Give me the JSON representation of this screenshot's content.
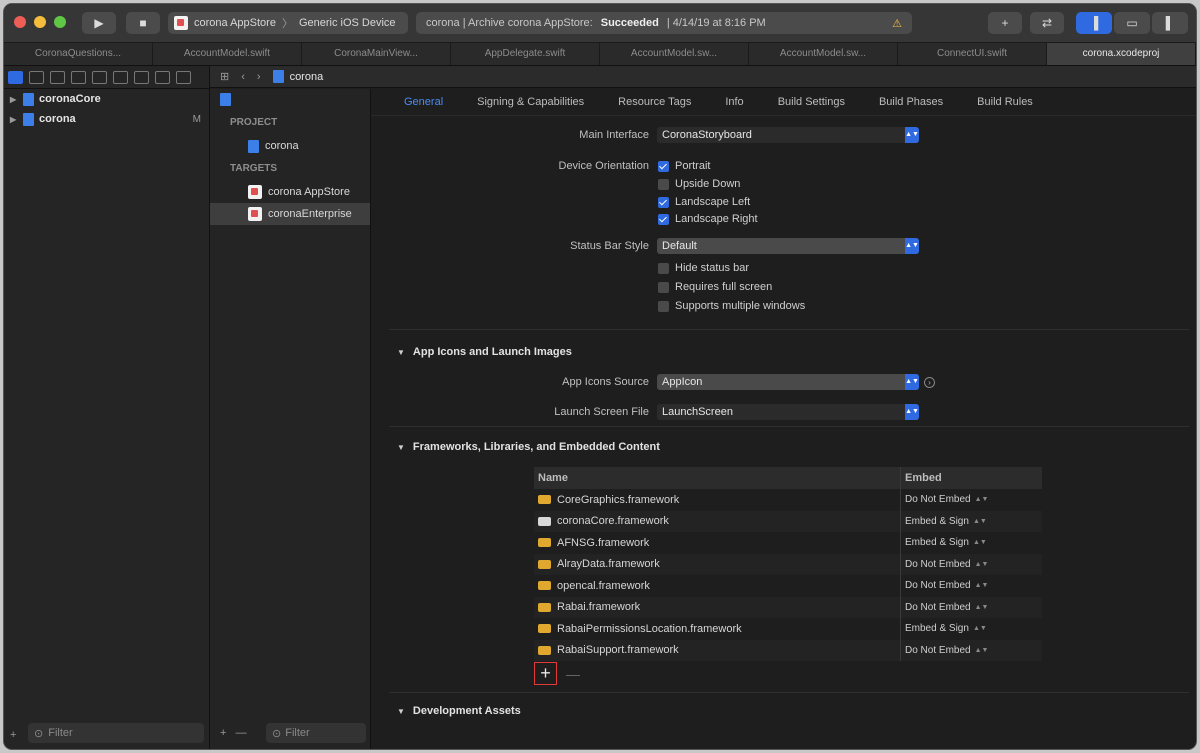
{
  "toolbar": {
    "run_icon": "play-icon",
    "stop_icon": "stop-icon",
    "scheme": "corona AppStore",
    "device": "Generic iOS Device",
    "activity_project": "corona | Archive corona AppStore:",
    "activity_status": "Succeeded",
    "activity_time": "| 4/14/19 at 8:16 PM",
    "warning_icon": "warning-icon"
  },
  "tabs": [
    "CoronaQuestions...",
    "AccountModel.swift",
    "CoronaMainView...",
    "AppDelegate.swift",
    "AccountModel.sw...",
    "AccountModel.sw...",
    "ConnectUI.swift",
    "corona.xcodeproj"
  ],
  "navigator": {
    "items": [
      {
        "label": "coronaCore",
        "badge": ""
      },
      {
        "label": "corona",
        "badge": "M"
      }
    ],
    "filter_placeholder": "Filter"
  },
  "jumpbar": {
    "file": "corona"
  },
  "targets": {
    "project_header": "PROJECT",
    "project_item": "corona",
    "targets_header": "TARGETS",
    "target_items": [
      "corona AppStore",
      "coronaEnterprise"
    ],
    "filter_placeholder": "Filter"
  },
  "segments": [
    "General",
    "Signing & Capabilities",
    "Resource Tags",
    "Info",
    "Build Settings",
    "Build Phases",
    "Build Rules"
  ],
  "deployment": {
    "main_interface_label": "Main Interface",
    "main_interface_value": "CoronaStoryboard",
    "orientation_label": "Device Orientation",
    "orientations": [
      {
        "label": "Portrait",
        "checked": true
      },
      {
        "label": "Upside Down",
        "checked": false
      },
      {
        "label": "Landscape Left",
        "checked": true
      },
      {
        "label": "Landscape Right",
        "checked": true
      }
    ],
    "status_bar_label": "Status Bar Style",
    "status_bar_value": "Default",
    "status_options": [
      {
        "label": "Hide status bar",
        "checked": false
      },
      {
        "label": "Requires full screen",
        "checked": false
      },
      {
        "label": "Supports multiple windows",
        "checked": false
      }
    ]
  },
  "app_icons": {
    "title": "App Icons and Launch Images",
    "source_label": "App Icons Source",
    "source_value": "AppIcon",
    "launch_label": "Launch Screen File",
    "launch_value": "LaunchScreen"
  },
  "frameworks": {
    "title": "Frameworks, Libraries, and Embedded Content",
    "col_name": "Name",
    "col_embed": "Embed",
    "rows": [
      {
        "name": "CoreGraphics.framework",
        "embed": "Do Not Embed"
      },
      {
        "name": "coronaCore.framework",
        "embed": "Embed & Sign"
      },
      {
        "name": "AFNSG.framework",
        "embed": "Embed & Sign"
      },
      {
        "name": "AlrayData.framework",
        "embed": "Do Not Embed"
      },
      {
        "name": "opencal.framework",
        "embed": "Do Not Embed"
      },
      {
        "name": "Rabai.framework",
        "embed": "Do Not Embed"
      },
      {
        "name": "RabaiPermissionsLocation.framework",
        "embed": "Embed & Sign"
      },
      {
        "name": "RabaiSupport.framework",
        "embed": "Do Not Embed"
      }
    ],
    "add_label": "+",
    "remove_label": "—"
  },
  "development_assets": {
    "title": "Development Assets"
  },
  "colors": {
    "accent": "#2f6ae0",
    "highlight": "#e03a3a"
  }
}
